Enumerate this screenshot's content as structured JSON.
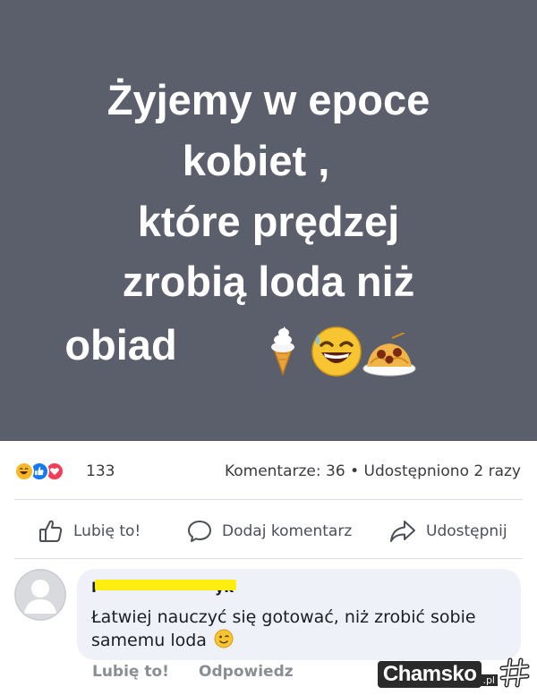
{
  "post": {
    "lines": [
      "Żyjemy w epoce",
      "kobiet ,",
      "które prędzej",
      "zrobią loda niż",
      "obiad"
    ],
    "background_color": "#5b5f6c",
    "emojis": [
      "ice-cream-icon",
      "laughing-sweat-emoji",
      "spaghetti-icon"
    ]
  },
  "stats": {
    "reaction_icons": [
      "haha-reaction-icon",
      "like-reaction-icon",
      "love-reaction-icon"
    ],
    "reaction_count": "133",
    "comments_label": "Komentarze: 36",
    "separator": "•",
    "shares_label": "Udostępniono 2 razy"
  },
  "actions": {
    "like": "Lubię to!",
    "comment": "Dodaj komentarz",
    "share": "Udostępnij"
  },
  "comment": {
    "author": "P",
    "author_suffix": "yk",
    "text": "Łatwiej nauczyć się gotować, niż zrobić sobie samemu loda",
    "emoji": "winking-emoji",
    "like": "Lubię to!",
    "reply": "Odpowiedz"
  },
  "watermark": {
    "brand": "Chamsko",
    "suffix": ".pl"
  },
  "colors": {
    "accent_blue": "#1877f2",
    "love_red": "#f33e58",
    "haha_yellow": "#f7b928"
  }
}
